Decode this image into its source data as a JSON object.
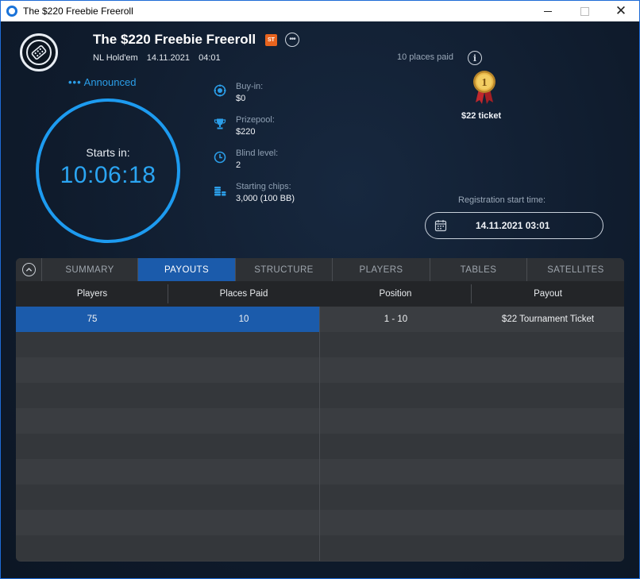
{
  "window": {
    "title": "The $220 Freebie Freeroll",
    "controls": {
      "minimize": "minimize",
      "maximize": "maximize",
      "close": "✕"
    }
  },
  "tournament": {
    "title": "The $220 Freebie Freeroll",
    "badge": "ST",
    "more_icon": "•••",
    "game": "NL Hold'em",
    "date": "14.11.2021",
    "time": "04:01",
    "status_dots": "•••",
    "status": "Announced",
    "starts_label": "Starts in:",
    "countdown": "10:06:18"
  },
  "details": [
    {
      "icon": "chip-icon",
      "label": "Buy-in:",
      "value": "$0"
    },
    {
      "icon": "trophy-icon",
      "label": "Prizepool:",
      "value": "$220"
    },
    {
      "icon": "clock-icon",
      "label": "Blind level:",
      "value": "2"
    },
    {
      "icon": "chips-stack-icon",
      "label": "Starting chips:",
      "value": "3,000 (100 BB)"
    }
  ],
  "prizes": {
    "places_paid": "10 places paid",
    "info_icon": "i",
    "medal_number": "1",
    "ticket": "$22 ticket"
  },
  "registration": {
    "label": "Registration start time:",
    "value": "14.11.2021 03:01"
  },
  "tabs": [
    {
      "label": "SUMMARY",
      "active": false
    },
    {
      "label": "PAYOUTS",
      "active": true
    },
    {
      "label": "STRUCTURE",
      "active": false
    },
    {
      "label": "PLAYERS",
      "active": false
    },
    {
      "label": "TABLES",
      "active": false
    },
    {
      "label": "SATELLITES",
      "active": false
    }
  ],
  "payouts": {
    "headers": [
      "Players",
      "Places Paid",
      "Position",
      "Payout"
    ],
    "summary_row": {
      "players": "75",
      "places_paid": "10"
    },
    "rows": [
      {
        "position": "1 - 10",
        "payout": "$22 Tournament Ticket"
      }
    ]
  },
  "colors": {
    "accent": "#1d9bf0",
    "active_tab": "#1b5bab",
    "badge": "#e8641e",
    "background": "#0f1b2c"
  }
}
